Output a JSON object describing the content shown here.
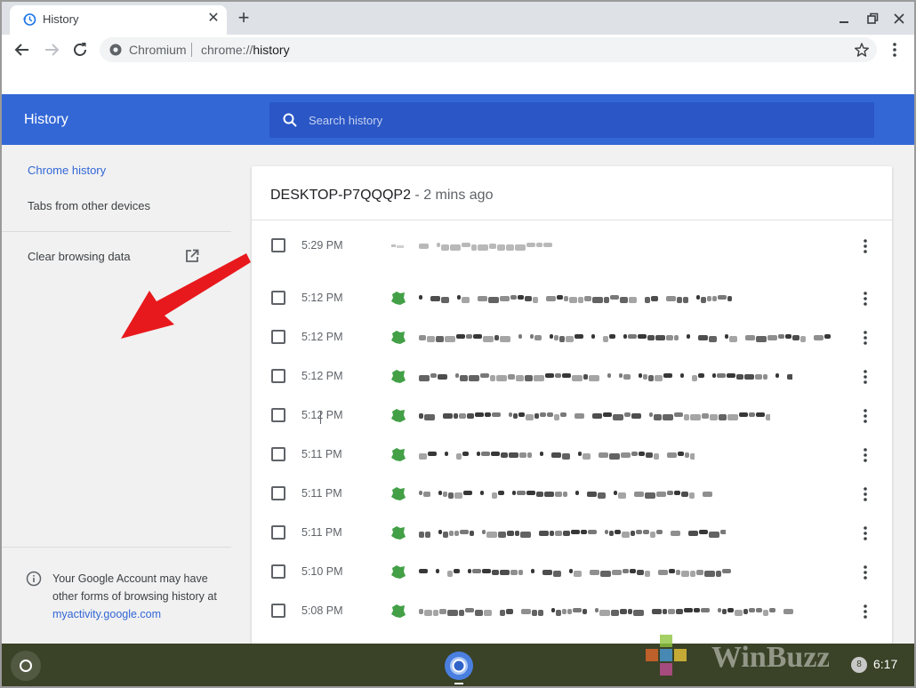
{
  "tab": {
    "title": "History",
    "close": "✕",
    "new_tab": "+"
  },
  "omnibox": {
    "site": "Chromium",
    "url_prefix": "chrome://",
    "url_path": "history"
  },
  "header": {
    "title": "History",
    "search_placeholder": "Search history"
  },
  "sidebar": {
    "items": [
      {
        "label": "Chrome history",
        "selected": true
      },
      {
        "label": "Tabs from other devices",
        "selected": false
      },
      {
        "label": "Clear browsing data",
        "selected": false
      }
    ],
    "footer_text": "Your Google Account may have other forms of browsing history at",
    "footer_link": "myactivity.google.com"
  },
  "card": {
    "device": "DESKTOP-P7QQQP2",
    "separator": " - ",
    "time_ago": "2 mins ago",
    "rows": [
      {
        "time": "5:29 PM"
      },
      {
        "time": "5:12 PM"
      },
      {
        "time": "5:12 PM"
      },
      {
        "time": "5:12 PM"
      },
      {
        "time": "5:12 PM"
      },
      {
        "time": "5:11 PM"
      },
      {
        "time": "5:11 PM"
      },
      {
        "time": "5:11 PM"
      },
      {
        "time": "5:10 PM"
      },
      {
        "time": "5:08 PM"
      }
    ]
  },
  "shelf": {
    "notification_count": "8",
    "clock": "6:17"
  },
  "watermark": {
    "text": "WinBuzzer"
  },
  "colors": {
    "accent": "#3367d6",
    "search_bg": "#2a56c6",
    "shelf": "#3a4227",
    "annotation": "#e8191d"
  }
}
